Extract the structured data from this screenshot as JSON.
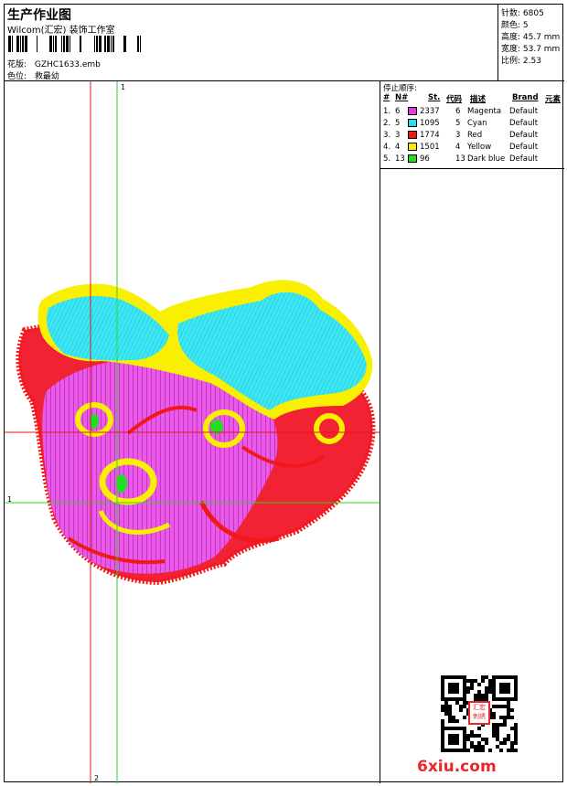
{
  "header": {
    "title": "生产作业图",
    "subtitle": "Wilcom(汇宏) 装饰工作室",
    "design_label": "花版:",
    "design_file": "GZHC1633.emb",
    "colorway_label": "色位:",
    "colorway_value": "救最幼"
  },
  "stats": {
    "stitches": "针数: 6805",
    "colors": "颜色: 5",
    "height": "高度: 45.7 mm",
    "width": "宽度: 53.7 mm",
    "ratio": "比例: 2.53"
  },
  "stop_sequence": {
    "title": "停止顺序:",
    "columns": [
      "#",
      "N#",
      "St.",
      "代码",
      "描述",
      "Brand",
      "元素"
    ],
    "rows": [
      {
        "num": "1.",
        "n": "6",
        "st": "2337",
        "code": "6",
        "desc": "Magenta",
        "brand": "Default",
        "color": "#e23be0"
      },
      {
        "num": "2.",
        "n": "5",
        "st": "1095",
        "code": "5",
        "desc": "Cyan",
        "brand": "Default",
        "color": "#22e0f0"
      },
      {
        "num": "3.",
        "n": "3",
        "st": "1774",
        "code": "3",
        "desc": "Red",
        "brand": "Default",
        "color": "#f01818"
      },
      {
        "num": "4.",
        "n": "4",
        "st": "1501",
        "code": "4",
        "desc": "Yellow",
        "brand": "Default",
        "color": "#f8f000"
      },
      {
        "num": "5.",
        "n": "13",
        "st": "96",
        "code": "13",
        "desc": "Dark blue",
        "brand": "Default",
        "color": "#22dd22"
      }
    ]
  },
  "guides": {
    "green_top": "1",
    "green_left": "1",
    "red_bottom": "2"
  },
  "branding": {
    "site": "6xiu.com",
    "stamp_line1": "汇宏",
    "stamp_line2": "刺绣"
  }
}
